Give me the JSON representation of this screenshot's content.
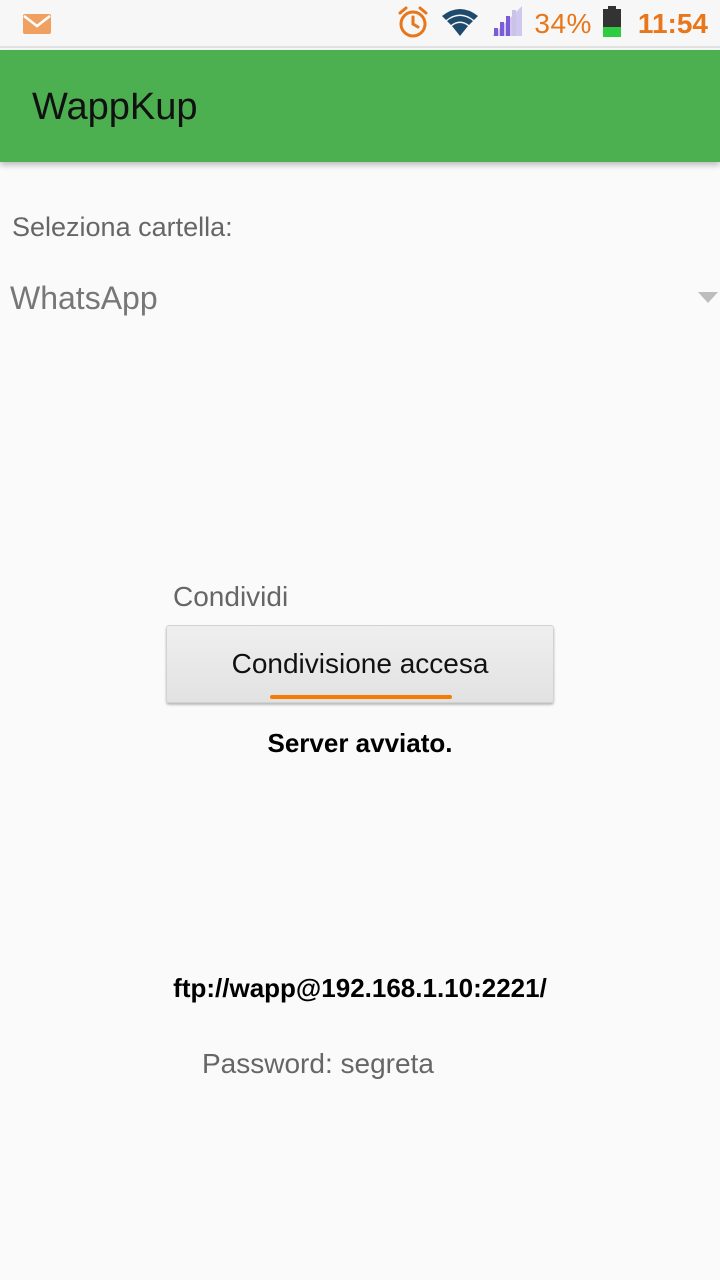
{
  "status_bar": {
    "icons": [
      "mail-icon",
      "alarm-icon",
      "wifi-icon",
      "signal-icon",
      "battery-icon"
    ],
    "battery_percent": "34%",
    "time": "11:54",
    "accent_color": "#e8761a"
  },
  "app_bar": {
    "title": "WappKup",
    "color": "#4caf50"
  },
  "folder": {
    "label": "Seleziona cartella:",
    "selected": "WhatsApp"
  },
  "share": {
    "label": "Condividi",
    "button_label": "Condivisione accesa",
    "state": "on",
    "indicator_color": "#f57c00"
  },
  "server": {
    "status": "Server avviato.",
    "url": "ftp://wapp@192.168.1.10:2221/",
    "password": "Password: segreta"
  }
}
